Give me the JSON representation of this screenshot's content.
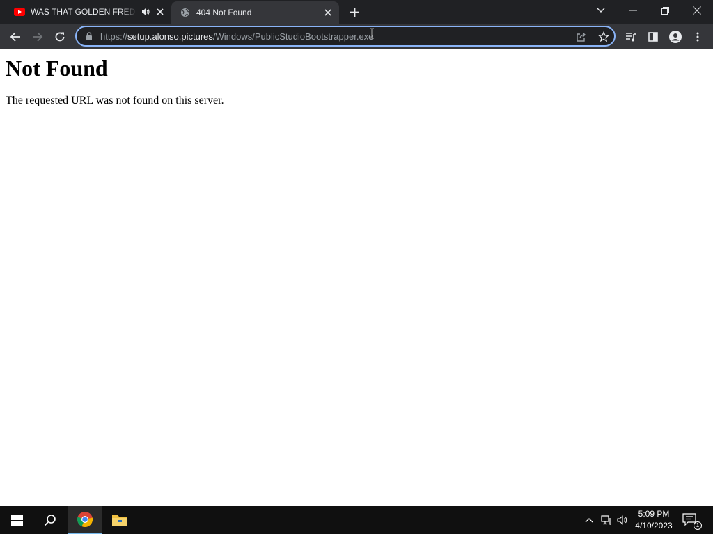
{
  "browser": {
    "tabs": [
      {
        "title": "WAS THAT GOLDEN FREDDY",
        "favicon": "youtube-icon",
        "audio": "speaker-icon",
        "active": false
      },
      {
        "title": "404 Not Found",
        "favicon": "globe-icon",
        "active": true
      }
    ],
    "address": {
      "scheme": "https://",
      "host": "setup.alonso.pictures",
      "path": "/Windows/PublicStudioBootstrapper.exe"
    },
    "colors": {
      "tabstrip": "#202124",
      "toolbar": "#35363a",
      "focus_ring": "#8ab4f8",
      "youtube_red": "#ff0000"
    }
  },
  "page": {
    "heading": "Not Found",
    "message": "The requested URL was not found on this server."
  },
  "taskbar": {
    "apps": [
      "windows-start-icon",
      "search-icon",
      "chrome-icon",
      "file-explorer-icon"
    ],
    "clock": {
      "time": "5:09 PM",
      "date": "4/10/2023"
    },
    "notification_count": "1"
  }
}
